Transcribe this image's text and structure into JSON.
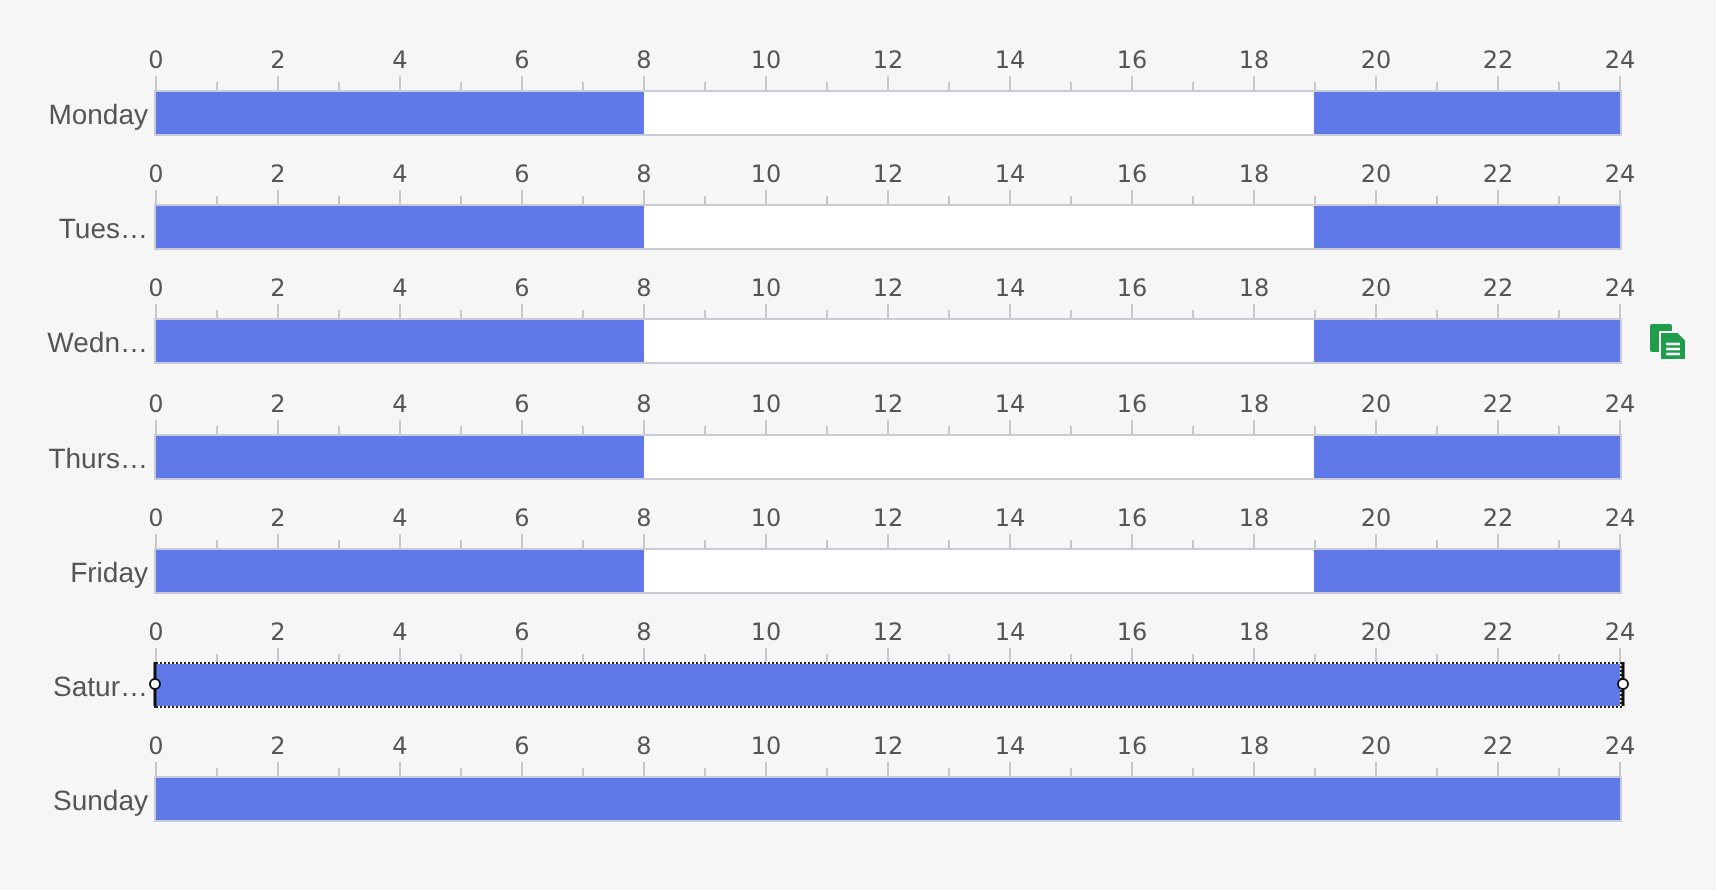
{
  "days": [
    {
      "label": "Monday",
      "selected": false,
      "copy_button": false,
      "ticks": [
        "0",
        "2",
        "4",
        "6",
        "8",
        "10",
        "12",
        "14",
        "16",
        "18",
        "20",
        "22",
        "24"
      ],
      "segments": [
        {
          "kind": "scheduled",
          "level": 0.3333
        },
        {
          "kind": "free"
        },
        {
          "kind": "scheduled",
          "level": 0.2084
        }
      ]
    },
    {
      "label": "Tues…",
      "selected": false,
      "copy_button": false,
      "ticks": [
        "0",
        "2",
        "4",
        "6",
        "8",
        "10",
        "12",
        "14",
        "16",
        "18",
        "20",
        "22",
        "24"
      ],
      "segments": [
        {
          "kind": "scheduled",
          "level": 0.3333
        },
        {
          "kind": "free"
        },
        {
          "kind": "scheduled",
          "level": 0.2084
        }
      ]
    },
    {
      "label": "Wedn…",
      "selected": false,
      "copy_button": true,
      "ticks": [
        "0",
        "2",
        "4",
        "6",
        "8",
        "10",
        "12",
        "14",
        "16",
        "18",
        "20",
        "22",
        "24"
      ],
      "segments": [
        {
          "kind": "scheduled",
          "level": 0.3333
        },
        {
          "kind": "free"
        },
        {
          "kind": "scheduled",
          "level": 0.2084
        }
      ]
    },
    {
      "label": "Thurs…",
      "selected": false,
      "copy_button": false,
      "ticks": [
        "0",
        "2",
        "4",
        "6",
        "8",
        "10",
        "12",
        "14",
        "16",
        "18",
        "20",
        "22",
        "24"
      ],
      "segments": [
        {
          "kind": "scheduled",
          "level": 0.3333
        },
        {
          "kind": "free"
        },
        {
          "kind": "scheduled",
          "level": 0.2084
        }
      ]
    },
    {
      "label": "Friday",
      "selected": false,
      "copy_button": false,
      "ticks": [
        "0",
        "2",
        "4",
        "6",
        "8",
        "10",
        "12",
        "14",
        "16",
        "18",
        "20",
        "22",
        "24"
      ],
      "segments": [
        {
          "kind": "scheduled",
          "level": 0.3333
        },
        {
          "kind": "free"
        },
        {
          "kind": "scheduled",
          "level": 0.2084
        }
      ]
    },
    {
      "label": "Satur…",
      "selected": true,
      "copy_button": false,
      "ticks": [
        "0",
        "2",
        "4",
        "6",
        "8",
        "10",
        "12",
        "14",
        "16",
        "18",
        "20",
        "22",
        "24"
      ],
      "segments": [
        {
          "kind": "scheduled",
          "level": 1
        }
      ]
    },
    {
      "label": "Sunday",
      "selected": false,
      "copy_button": false,
      "ticks": [
        "0",
        "2",
        "4",
        "6",
        "8",
        "10",
        "12",
        "14",
        "16",
        "18",
        "20",
        "22",
        "24"
      ],
      "segments": [
        {
          "kind": "scheduled",
          "level": 1
        }
      ]
    }
  ]
}
